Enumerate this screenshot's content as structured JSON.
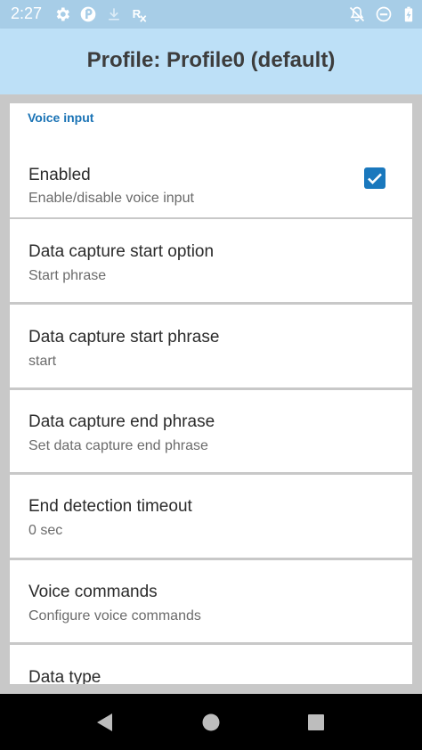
{
  "status_bar": {
    "time": "2:27",
    "icons": [
      "gear-icon",
      "app-icon",
      "download-icon",
      "rx-icon",
      "notifications-off-icon",
      "do-not-disturb-icon",
      "battery-icon"
    ]
  },
  "app_bar": {
    "title": "Profile: Profile0 (default)"
  },
  "section": {
    "header": "Voice input"
  },
  "prefs": [
    {
      "title": "Enabled",
      "summary": "Enable/disable voice input",
      "checked": true
    },
    {
      "title": "Data capture start option",
      "summary": "Start phrase"
    },
    {
      "title": "Data capture start phrase",
      "summary": "start"
    },
    {
      "title": "Data capture end phrase",
      "summary": "Set data capture end phrase"
    },
    {
      "title": "End detection timeout",
      "summary": "0 sec"
    },
    {
      "title": "Voice commands",
      "summary": "Configure voice commands"
    },
    {
      "title": "Data type",
      "summary": ""
    }
  ],
  "nav_bar": {
    "icons": [
      "back-icon",
      "home-icon",
      "recents-icon"
    ]
  },
  "colors": {
    "status_bar": "#a7cde7",
    "app_bar": "#bde0f7",
    "accent": "#1a78bd",
    "section_header": "#1a73b5"
  }
}
